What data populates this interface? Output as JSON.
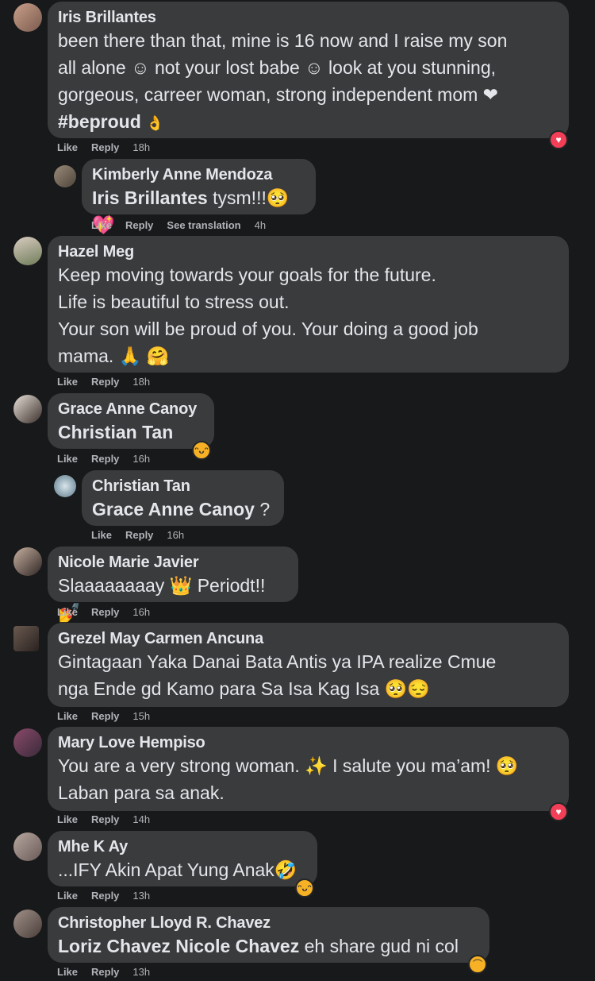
{
  "comments": [
    {
      "author": "Iris Brillantes",
      "line1": "been there than that, mine is 16 now and I raise my son",
      "line2": "all alone ☺ not your lost babe ☺ look at you stunning,",
      "line3": "gorgeous, carreer woman, strong independent mom ❤",
      "line4": "#beproud",
      "line4_emoji": "👌",
      "like": "Like",
      "reply": "Reply",
      "time": "18h",
      "reaction": "love"
    },
    {
      "author": "Kimberly Anne Mendoza",
      "tag": "Iris Brillantes",
      "text": "tysm!!!🥺💖",
      "like": "Like",
      "reply": "Reply",
      "see_translation": "See translation",
      "time": "4h"
    },
    {
      "author": "Hazel Meg",
      "line1": "Keep moving towards your goals for the future.",
      "line2": "Life is beautiful to stress out.",
      "line3": "Your son will be proud of you. Your doing a good job",
      "line4": "mama. 🙏 🤗",
      "like": "Like",
      "reply": "Reply",
      "time": "18h"
    },
    {
      "author": "Grace Anne Canoy",
      "tag": "Christian Tan",
      "like": "Like",
      "reply": "Reply",
      "time": "16h",
      "reaction": "haha"
    },
    {
      "author": "Christian Tan",
      "tag": "Grace Anne Canoy",
      "text": "?",
      "like": "Like",
      "reply": "Reply",
      "time": "16h"
    },
    {
      "author": "Nicole Marie Javier",
      "text": "Slaaaaaaaay 👑 Periodt!! 💅",
      "like": "Like",
      "reply": "Reply",
      "time": "16h"
    },
    {
      "author": "Grezel May Carmen Ancuna",
      "line1": "Gintagaan Yaka Danai Bata Antis ya IPA realize Cmue",
      "line2": "nga Ende gd Kamo para Sa Isa Kag Isa 🥺😔",
      "like": "Like",
      "reply": "Reply",
      "time": "15h"
    },
    {
      "author": "Mary Love Hempiso",
      "line1": "You are a very strong woman. ✨ I salute you ma’am! 🥺",
      "line2": "Laban para sa anak.",
      "like": "Like",
      "reply": "Reply",
      "time": "14h",
      "reaction": "love"
    },
    {
      "author": "Mhe K Ay",
      "text": "...IFY Akin Apat Yung Anak🤣",
      "like": "Like",
      "reply": "Reply",
      "time": "13h",
      "reaction": "haha"
    },
    {
      "author": "Christopher Lloyd R. Chavez",
      "tag": "Loriz Chavez Nicole Chavez",
      "text": "eh share gud ni col",
      "like": "Like",
      "reply": "Reply",
      "time": "13h",
      "reaction": "sad"
    }
  ],
  "colors": {
    "background": "#18191a",
    "bubble": "#3a3b3c",
    "text": "#e4e6eb",
    "muted": "#b0b3b8",
    "love": "#f33e58",
    "haha": "#f7b125"
  },
  "icons": {
    "love": "heart-icon",
    "haha": "laughing-face-icon",
    "sad": "sad-face-icon"
  }
}
